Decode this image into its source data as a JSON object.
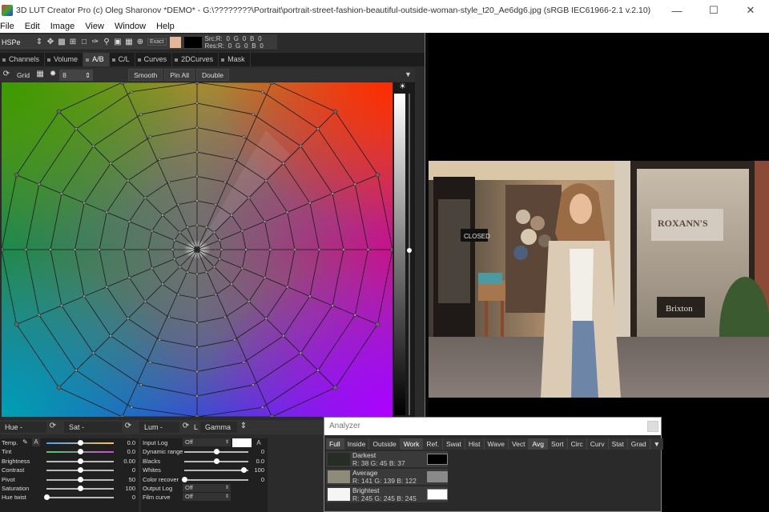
{
  "window": {
    "title": "3D LUT Creator Pro (c) Oleg Sharonov *DEMO* - G:\\????????\\Portrait\\portrait-street-fashion-beautiful-outside-woman-style_t20_Ae6dg6.jpg (sRGB IEC61966-2.1 v.2.10)"
  },
  "menu": [
    "File",
    "Edit",
    "Image",
    "View",
    "Window",
    "Help"
  ],
  "toolbar": {
    "mode": "HSPe",
    "exact_label": "Exact",
    "swatch_color": "#e3b797",
    "src": {
      "label": "Src:",
      "r": "0",
      "g": "0",
      "b": "0"
    },
    "res": {
      "label": "Res:",
      "r": "0",
      "g": "0",
      "b": "0"
    }
  },
  "tabs": [
    {
      "label": "Channels",
      "active": false
    },
    {
      "label": "Volume",
      "active": false
    },
    {
      "label": "A/B",
      "active": true
    },
    {
      "label": "C/L",
      "active": false
    },
    {
      "label": "Curves",
      "active": false
    },
    {
      "label": "2DCurves",
      "active": false
    },
    {
      "label": "Mask",
      "active": false
    }
  ],
  "gridbar": {
    "grid_label": "Grid",
    "grid_value": "8",
    "smooth_label": "Smooth",
    "pinall_label": "Pin All",
    "double_label": "Double"
  },
  "huebar": {
    "hue_label": "Hue -",
    "sat_label": "Sat -",
    "lum_label": "Lum -",
    "l_label": "L",
    "gamma_label": "Gamma"
  },
  "adjust_left": [
    {
      "label": "Temp.",
      "value": "0.0",
      "pos": 0.5
    },
    {
      "label": "Tint",
      "value": "0.0",
      "pos": 0.5
    },
    {
      "label": "Brightness",
      "value": "0.00",
      "pos": 0.5
    },
    {
      "label": "Contrast",
      "value": "0",
      "pos": 0.5
    },
    {
      "label": "Pivot",
      "value": "50",
      "pos": 0.5
    },
    {
      "label": "Saturation",
      "value": "100",
      "pos": 0.5
    },
    {
      "label": "Hue twist",
      "value": "0",
      "pos": 0.0
    }
  ],
  "adjust_right": {
    "input_log": {
      "label": "Input Log",
      "value": "Off"
    },
    "dynamic_range": {
      "label": "Dynamic range",
      "value": "0",
      "pos": 0.5
    },
    "blacks": {
      "label": "Blacks",
      "value": "0.0",
      "pos": 0.5
    },
    "whites": {
      "label": "Whites",
      "value": "100",
      "pos": 1.0
    },
    "color_recover": {
      "label": "Color recover",
      "value": "0",
      "pos": 0.0
    },
    "output_log": {
      "label": "Output Log",
      "value": "Off"
    },
    "film_curve": {
      "label": "Film curve",
      "value": "Off"
    },
    "a_label": "A"
  },
  "analyzer": {
    "title": "Analyzer",
    "tabs": [
      {
        "label": "Full",
        "on": true
      },
      {
        "label": "Inside",
        "on": false
      },
      {
        "label": "Outside",
        "on": false
      },
      {
        "label": "Work",
        "on": true
      },
      {
        "label": "Ref.",
        "on": false
      },
      {
        "label": "Swat",
        "on": false
      },
      {
        "label": "Hist",
        "on": false
      },
      {
        "label": "Wave",
        "on": false
      },
      {
        "label": "Vect",
        "on": false
      },
      {
        "label": "Avg",
        "on": true
      },
      {
        "label": "Sort",
        "on": false
      },
      {
        "label": "Circ",
        "on": false
      },
      {
        "label": "Curv",
        "on": false
      },
      {
        "label": "Stat",
        "on": false
      },
      {
        "label": "Grad",
        "on": false
      }
    ],
    "rows": [
      {
        "name": "Darkest",
        "rgb": "R: 38  G: 45  B: 37",
        "color": "#262d25",
        "preview": "#000000"
      },
      {
        "name": "Average",
        "rgb": "R: 141  G: 139  B: 122",
        "color": "#8d8b7a",
        "preview": "#8a8a8a"
      },
      {
        "name": "Brightest",
        "rgb": "R: 245  G: 245  B: 245",
        "color": "#f5f5f5",
        "preview": "#ffffff"
      }
    ]
  },
  "photo_text": {
    "closed_sign": "CLOSED",
    "store_sign": "ROXANN'S",
    "brand_sign": "Brixton"
  }
}
